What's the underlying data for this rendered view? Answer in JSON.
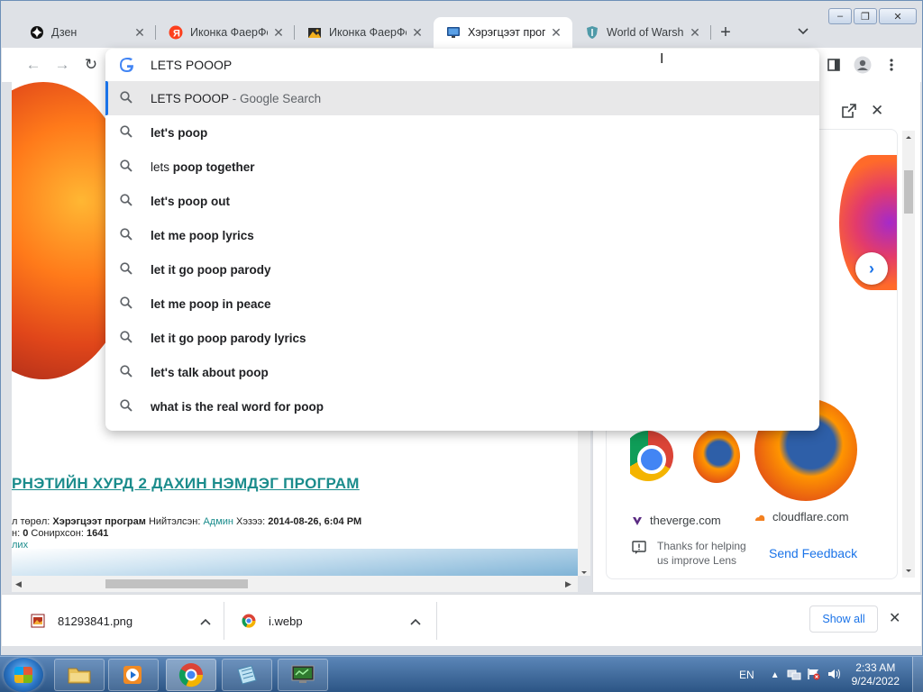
{
  "tabs": [
    {
      "title": "Дзен",
      "icon": "zen-icon",
      "active": false
    },
    {
      "title": "Иконка ФаерФокс",
      "icon": "yandex-icon",
      "active": false
    },
    {
      "title": "Иконка ФаерФокс",
      "icon": "image-icon",
      "active": false
    },
    {
      "title": "Хэрэгцээт програм",
      "icon": "monitor-icon",
      "active": true
    },
    {
      "title": "World of Warships",
      "icon": "shield-icon",
      "active": false
    }
  ],
  "omnibox": {
    "value": "LETS POOOP",
    "suggestions": [
      {
        "parts": [
          {
            "text": "LETS POOOP",
            "style": "plain"
          },
          {
            "text": " - Google Search",
            "style": "grey"
          }
        ],
        "selected": true
      },
      {
        "parts": [
          {
            "text": "let's poop",
            "style": "bold"
          }
        ]
      },
      {
        "parts": [
          {
            "text": "lets ",
            "style": "plain"
          },
          {
            "text": "poop together",
            "style": "bold"
          }
        ]
      },
      {
        "parts": [
          {
            "text": "let's poop out",
            "style": "bold"
          }
        ]
      },
      {
        "parts": [
          {
            "text": "let me poop lyrics",
            "style": "bold"
          }
        ]
      },
      {
        "parts": [
          {
            "text": "let it go poop parody",
            "style": "bold"
          }
        ]
      },
      {
        "parts": [
          {
            "text": "let me poop in peace",
            "style": "bold"
          }
        ]
      },
      {
        "parts": [
          {
            "text": "let it go poop parody lyrics",
            "style": "bold"
          }
        ]
      },
      {
        "parts": [
          {
            "text": "let's talk about poop",
            "style": "bold"
          }
        ]
      },
      {
        "parts": [
          {
            "text": "what is the real word for poop",
            "style": "bold"
          }
        ]
      }
    ]
  },
  "page": {
    "article_title": "РНЭТИЙН ХУРД 2 ДАХИН НЭМДЭГ ПРОГРАМ",
    "meta_line1_label1": "л төрөл: ",
    "meta_line1_value1": "Хэрэгцээт програм",
    "meta_line1_label2": " Нийтэлсэн: ",
    "meta_line1_link": "Админ",
    "meta_line1_label3": " Хэзээ: ",
    "meta_line1_value3": "2014-08-26, 6:04 PM",
    "meta_line2_label1": "н: ",
    "meta_line2_value1": "0",
    "meta_line2_label2": " Сонирхсон: ",
    "meta_line2_value2": "1641",
    "meta_line3_link": "лих"
  },
  "side_panel": {
    "source1": "theverge.com",
    "source2": "cloudflare.com",
    "feedback_text": "Thanks for helping us improve Lens",
    "send_feedback": "Send Feedback"
  },
  "downloads": [
    {
      "name": "81293841.png",
      "icon": "image-file-icon"
    },
    {
      "name": "i.webp",
      "icon": "chrome-file-icon"
    }
  ],
  "shelf": {
    "show_all": "Show all"
  },
  "taskbar": {
    "language": "EN",
    "time": "2:33 AM",
    "date": "9/24/2022"
  },
  "colors": {
    "accent": "#1a73e8",
    "link_teal": "#1b8c8c"
  }
}
